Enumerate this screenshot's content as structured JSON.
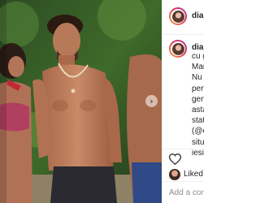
{
  "post": {
    "username": "dian",
    "media": {
      "alt": "Post photo"
    },
    "next_icon": "chevron-right-icon",
    "caption_lines": [
      "cu g",
      "Mar",
      "Nu e",
      "perf",
      "gen",
      "asta",
      "stat",
      "(@e",
      "situ",
      "iesir"
    ],
    "liked_by_text": "Liked by",
    "comment_placeholder": "Add a comm"
  },
  "colors": {
    "avatar_ring_start": "#f6a548",
    "avatar_ring_end": "#b02fa7",
    "divider": "#efefef",
    "text": "#262626",
    "muted": "#8e8e8e"
  }
}
